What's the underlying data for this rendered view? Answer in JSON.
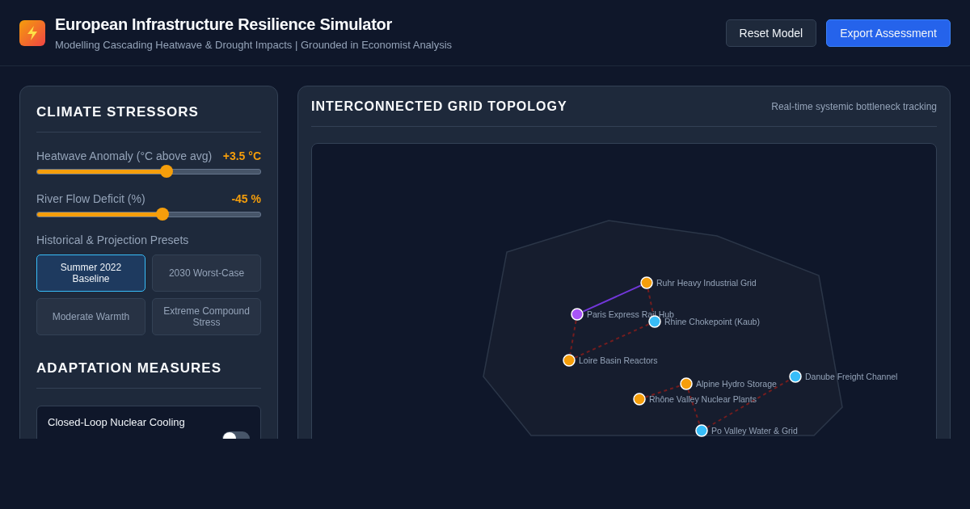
{
  "header": {
    "title": "European Infrastructure Resilience Simulator",
    "subtitle": "Modelling Cascading Heatwave & Drought Impacts | Grounded in Economist Analysis",
    "buttons": [
      {
        "label": "Reset Model",
        "kind": "secondary"
      },
      {
        "label": "Export Assessment",
        "kind": "primary"
      }
    ]
  },
  "climate_stressors": {
    "title": "CLIMATE STRESSORS",
    "sliders": [
      {
        "label": "Heatwave Anomaly (°C above avg)",
        "reading": "+3.5 °C",
        "level": 0.58
      },
      {
        "label": "River Flow Deficit (%)",
        "reading": "-45 %",
        "level": 0.56
      }
    ],
    "presets_label": "Historical & Projection Presets",
    "presets": [
      {
        "label": "Summer 2022 Baseline",
        "selected": true
      },
      {
        "label": "2030 Worst-Case",
        "selected": false
      },
      {
        "label": "Moderate Warmth",
        "selected": false
      },
      {
        "label": "Extreme Compound Stress",
        "selected": false
      }
    ]
  },
  "adaptation_measures": {
    "title": "ADAPTATION MEASURES",
    "toggles": [
      {
        "label": "Closed-Loop Nuclear Cooling",
        "on": false
      }
    ]
  },
  "topology": {
    "title": "INTERCONNECTED GRID TOPOLOGY",
    "subtitle": "Real-time systemic bottleneck tracking",
    "nodes": [
      {
        "label": "Ruhr Heavy Industrial Grid",
        "color": "#f59e0b"
      },
      {
        "label": "Paris Express Rail Hub",
        "color": "#a855f7"
      },
      {
        "label": "Rhine Chokepoint (Kaub)",
        "color": "#38bdf8"
      },
      {
        "label": "Loire Basin Reactors",
        "color": "#f59e0b"
      },
      {
        "label": "Alpine Hydro Storage",
        "color": "#f59e0b"
      },
      {
        "label": "Danube Freight Channel",
        "color": "#38bdf8"
      },
      {
        "label": "Rhône Valley Nuclear Plants",
        "color": "#f59e0b"
      },
      {
        "label": "Po Valley Water & Grid",
        "color": "#38bdf8"
      }
    ],
    "links": [
      {
        "kind": "active"
      },
      {
        "kind": "stressed"
      },
      {
        "kind": "stressed"
      },
      {
        "kind": "stressed"
      },
      {
        "kind": "stressed"
      },
      {
        "kind": "stressed"
      },
      {
        "kind": "stressed"
      }
    ]
  }
}
